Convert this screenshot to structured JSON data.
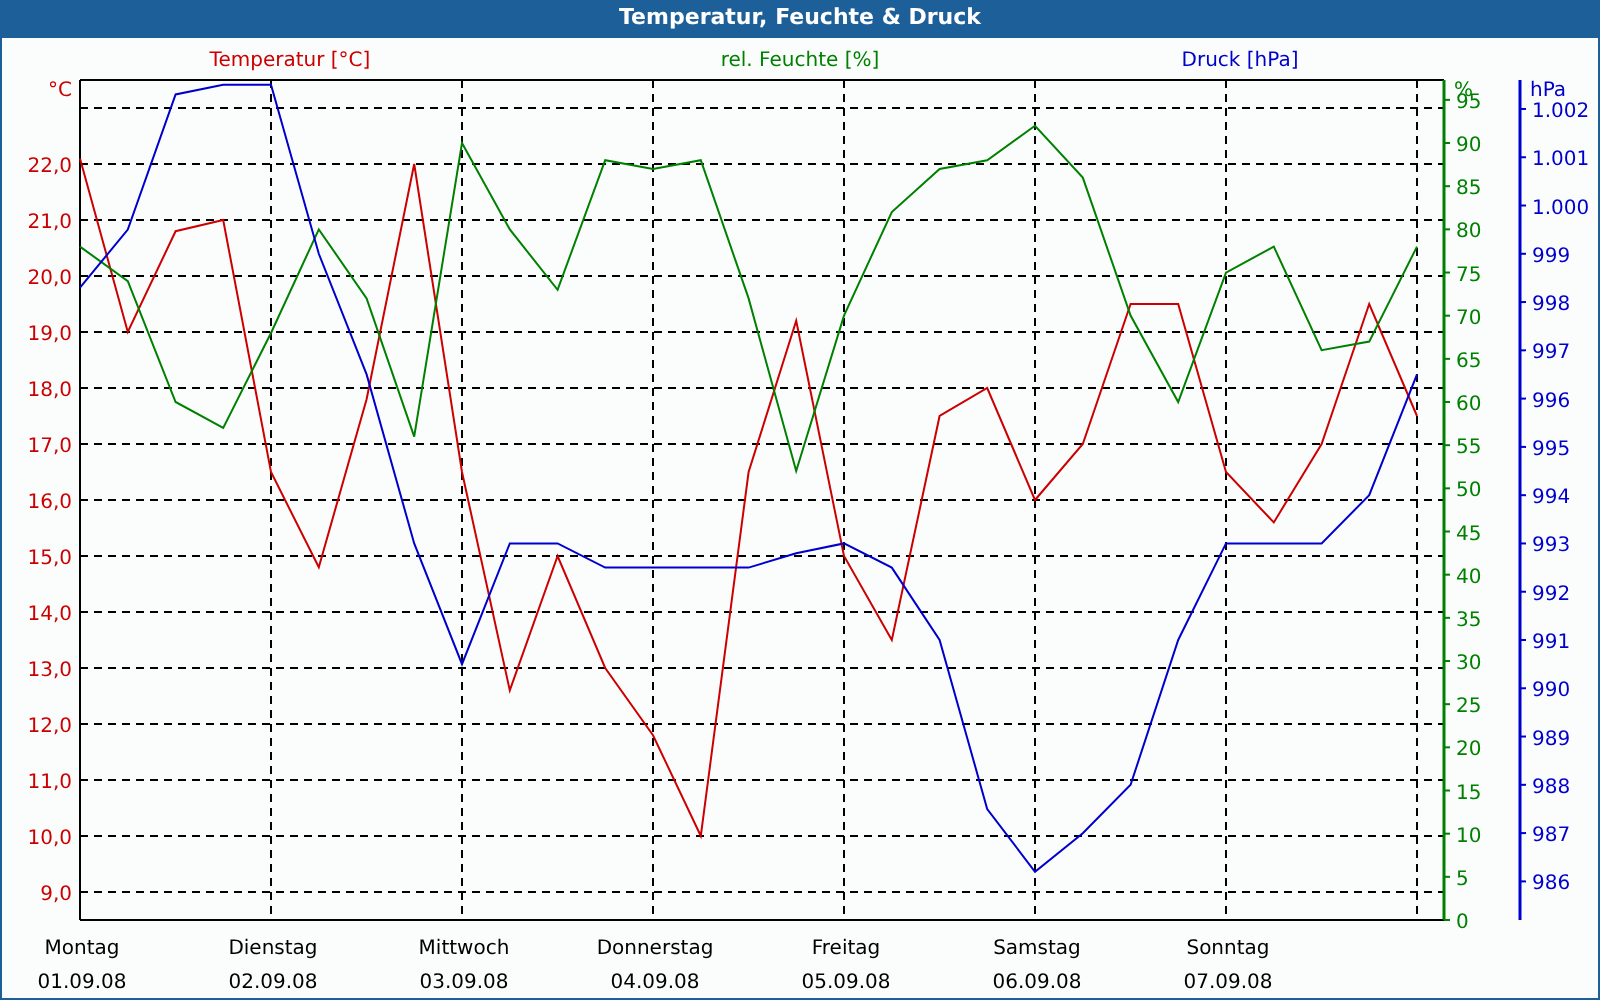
{
  "window": {
    "title": "Temperatur, Feuchte & Druck"
  },
  "layers": [
    {
      "chart_data": {
        "type": "line",
        "grid": true,
        "ylabel": "°C",
        "categories": [
          "Montag",
          null,
          null,
          null,
          "Dienstag",
          null,
          null,
          null,
          "Mittwoch",
          null,
          null,
          null,
          "Donnerstag",
          null,
          null,
          null,
          "Freitag",
          null,
          null,
          null,
          "Samstag",
          null,
          null,
          null,
          "Sonntag",
          null,
          null,
          null,
          null
        ],
        "ylim": [
          8.5,
          23.5
        ],
        "yticks": [
          {
            "value": 9,
            "label": "9,0"
          },
          {
            "value": 10,
            "label": "10,0"
          },
          {
            "value": 11,
            "label": "11,0"
          },
          {
            "value": 12,
            "label": "12,0"
          },
          {
            "value": 13,
            "label": "13,0"
          },
          {
            "value": 14,
            "label": "14,0"
          },
          {
            "value": 15,
            "label": "15,0"
          },
          {
            "value": 16,
            "label": "16,0"
          },
          {
            "value": 17,
            "label": "17,0"
          },
          {
            "value": 18,
            "label": "18,0"
          },
          {
            "value": 19,
            "label": "19,0"
          },
          {
            "value": 20,
            "label": "20,0"
          },
          {
            "value": 21,
            "label": "21,0"
          },
          {
            "value": 22,
            "label": "22,0"
          }
        ],
        "series": [
          {
            "name": "Temperatur [°C]",
            "color": "#cc0000",
            "values": [
              22.1,
              19.0,
              20.8,
              21.0,
              16.5,
              14.8,
              17.8,
              22.0,
              16.5,
              12.6,
              15.0,
              13.0,
              11.8,
              10.0,
              16.5,
              19.2,
              15.0,
              13.5,
              17.5,
              18.0,
              16.0,
              17.0,
              19.5,
              19.5,
              16.5,
              15.6,
              17.0,
              19.5,
              17.5
            ]
          }
        ]
      }
    },
    {
      "chart_data": {
        "type": "line",
        "ylabel": "%",
        "categories": [
          null,
          null,
          null,
          null,
          null,
          null,
          null,
          null,
          null,
          null,
          null,
          null,
          null,
          null,
          null,
          null,
          null,
          null,
          null,
          null,
          null,
          null,
          null,
          null,
          null,
          null,
          null,
          null,
          null
        ],
        "ylim": [
          0,
          97.3
        ],
        "yticks": [
          {
            "value": 0,
            "label": "0"
          },
          {
            "value": 5,
            "label": "5"
          },
          {
            "value": 10,
            "label": "10"
          },
          {
            "value": 15,
            "label": "15"
          },
          {
            "value": 20,
            "label": "20"
          },
          {
            "value": 25,
            "label": "25"
          },
          {
            "value": 30,
            "label": "30"
          },
          {
            "value": 35,
            "label": "35"
          },
          {
            "value": 40,
            "label": "40"
          },
          {
            "value": 45,
            "label": "45"
          },
          {
            "value": 50,
            "label": "50"
          },
          {
            "value": 55,
            "label": "55"
          },
          {
            "value": 60,
            "label": "60"
          },
          {
            "value": 65,
            "label": "65"
          },
          {
            "value": 70,
            "label": "70"
          },
          {
            "value": 75,
            "label": "75"
          },
          {
            "value": 80,
            "label": "80"
          },
          {
            "value": 85,
            "label": "85"
          },
          {
            "value": 90,
            "label": "90"
          },
          {
            "value": 95,
            "label": "95"
          }
        ],
        "series": [
          {
            "name": "rel. Feuchte [%]",
            "color": "#008000",
            "values": [
              78,
              74,
              60,
              57,
              68,
              80,
              72,
              56,
              90,
              80,
              73,
              88,
              87,
              88,
              72,
              52,
              70,
              82,
              87,
              88,
              92,
              86,
              70,
              60,
              75,
              78,
              66,
              67,
              78
            ]
          }
        ]
      }
    },
    {
      "chart_data": {
        "type": "line",
        "ylabel": "hPa",
        "categories": [
          null,
          null,
          null,
          null,
          null,
          null,
          null,
          null,
          null,
          null,
          null,
          null,
          null,
          null,
          null,
          null,
          null,
          null,
          null,
          null,
          null,
          null,
          null,
          null,
          null,
          null,
          null,
          null,
          null
        ],
        "ylim": [
          985.2,
          1002.6
        ],
        "yticks": [
          {
            "value": 986,
            "label": "986"
          },
          {
            "value": 987,
            "label": "987"
          },
          {
            "value": 988,
            "label": "988"
          },
          {
            "value": 989,
            "label": "989"
          },
          {
            "value": 990,
            "label": "990"
          },
          {
            "value": 991,
            "label": "991"
          },
          {
            "value": 992,
            "label": "992"
          },
          {
            "value": 993,
            "label": "993"
          },
          {
            "value": 994,
            "label": "994"
          },
          {
            "value": 995,
            "label": "995"
          },
          {
            "value": 996,
            "label": "996"
          },
          {
            "value": 997,
            "label": "997"
          },
          {
            "value": 998,
            "label": "998"
          },
          {
            "value": 999,
            "label": "999"
          },
          {
            "value": 1000,
            "label": "1.000"
          },
          {
            "value": 1001,
            "label": "1.001"
          },
          {
            "value": 1002,
            "label": "1.002"
          }
        ],
        "series": [
          {
            "name": "Druck [hPa]",
            "color": "#0000cc",
            "values": [
              998.3,
              999.5,
              1002.3,
              1002.5,
              1002.5,
              999,
              996.5,
              993,
              990.5,
              993,
              993,
              992.5,
              992.5,
              992.5,
              992.5,
              992.8,
              993,
              992.5,
              991,
              987.5,
              986.2,
              987,
              988,
              991,
              993,
              993,
              993,
              994,
              996.5
            ]
          }
        ]
      }
    }
  ],
  "dates": [
    "01.09.08",
    "02.09.08",
    "03.09.08",
    "04.09.08",
    "05.09.08",
    "06.09.08",
    "07.09.08"
  ]
}
